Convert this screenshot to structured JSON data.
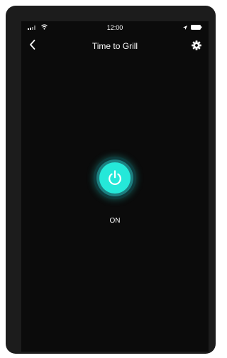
{
  "status_bar": {
    "time": "12:00",
    "icons": [
      "signal-icon",
      "wifi-icon",
      "location-icon",
      "battery-icon"
    ]
  },
  "nav": {
    "title": "Time to Grill",
    "back_icon": "chevron-left-icon",
    "settings_icon": "gear-icon"
  },
  "power": {
    "state_label": "ON",
    "icon": "power-icon",
    "accent_color": "#25e8d9",
    "is_on": true
  },
  "colors": {
    "background": "#0b0b0b",
    "frame": "#1c1c1c",
    "text": "#ffffff"
  }
}
